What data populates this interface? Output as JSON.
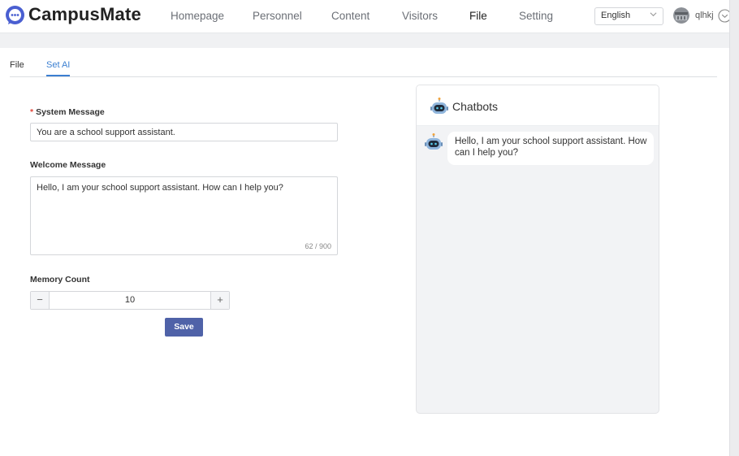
{
  "app": {
    "brand": "CampusMate",
    "brand_color": "#4a5fd1"
  },
  "nav": {
    "items": [
      {
        "label": "Homepage",
        "active": false
      },
      {
        "label": "Personnel",
        "active": false
      },
      {
        "label": "Content",
        "active": false
      },
      {
        "label": "Visitors",
        "active": false
      },
      {
        "label": "File",
        "active": true
      },
      {
        "label": "Setting",
        "active": false
      }
    ]
  },
  "header": {
    "language": "English",
    "username": "qlhkj",
    "icons": [
      "chevron-down-icon",
      "avatar",
      "circle-chevron-down-icon"
    ]
  },
  "tabs": [
    {
      "label": "File",
      "active": false
    },
    {
      "label": "Set AI",
      "active": true
    }
  ],
  "form": {
    "system_message": {
      "required_mark": "*",
      "label": "System Message",
      "value": "You are a school support assistant."
    },
    "welcome_message": {
      "label": "Welcome Message",
      "value": "Hello, I am your school support assistant. How can I help you?",
      "counter": "62 / 900"
    },
    "memory_count": {
      "label": "Memory Count",
      "value": "10",
      "minus": "−",
      "plus": "+"
    },
    "save_label": "Save"
  },
  "chatbot": {
    "title": "Chatbots",
    "message": "Hello, I am your school support assistant. How can I help you?",
    "icon": "robot-icon"
  },
  "colors": {
    "accent": "#3b7fd1",
    "primary_button": "#4f62a8",
    "required": "#e2473b"
  }
}
